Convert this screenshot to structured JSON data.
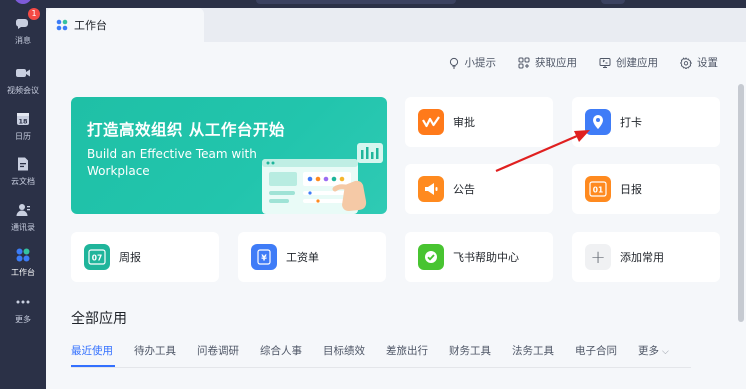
{
  "sidebar": {
    "items": [
      {
        "label": "消息",
        "icon": "chat-icon",
        "badge": "1"
      },
      {
        "label": "视频会议",
        "icon": "video-icon"
      },
      {
        "label": "日历",
        "icon": "calendar-icon",
        "icon_text": "18"
      },
      {
        "label": "云文档",
        "icon": "doc-icon"
      },
      {
        "label": "通讯录",
        "icon": "contacts-icon"
      },
      {
        "label": "工作台",
        "icon": "workspace-icon"
      },
      {
        "label": "更多",
        "icon": "more-icon"
      }
    ]
  },
  "tab": {
    "title": "工作台"
  },
  "toolbar": {
    "tips": "小提示",
    "get_apps": "获取应用",
    "create_app": "创建应用",
    "settings": "设置"
  },
  "banner": {
    "title": "打造高效组织 从工作台开始",
    "subtitle": "Build an Effective Team with Workplace"
  },
  "apps": {
    "approval": {
      "label": "审批",
      "color": "#ff7a1a"
    },
    "checkin": {
      "label": "打卡",
      "color": "#3f7cf7"
    },
    "announcement": {
      "label": "公告",
      "color": "#ff8a1f"
    },
    "daily_report": {
      "label": "日报",
      "icon_text": "01",
      "color": "#ff8a1f"
    },
    "weekly_report": {
      "label": "周报",
      "icon_text": "07",
      "color": "#1fb59b"
    },
    "payslip": {
      "label": "工资单",
      "icon_text": "¥",
      "color": "#3f7cf7"
    },
    "help_center": {
      "label": "飞书帮助中心",
      "color": "#48c431"
    },
    "add_common": {
      "label": "添加常用",
      "icon_text": "+"
    }
  },
  "all_apps": {
    "title": "全部应用",
    "categories": [
      "最近使用",
      "待办工具",
      "问卷调研",
      "综合人事",
      "目标绩效",
      "差旅出行",
      "财务工具",
      "法务工具",
      "电子合同"
    ],
    "more": "更多",
    "active_category": "最近使用"
  },
  "colors": {
    "accent": "#3370ff",
    "sidebar_bg": "#2b3147",
    "banner": "#22c5ad",
    "annotation_arrow": "#e02020"
  }
}
